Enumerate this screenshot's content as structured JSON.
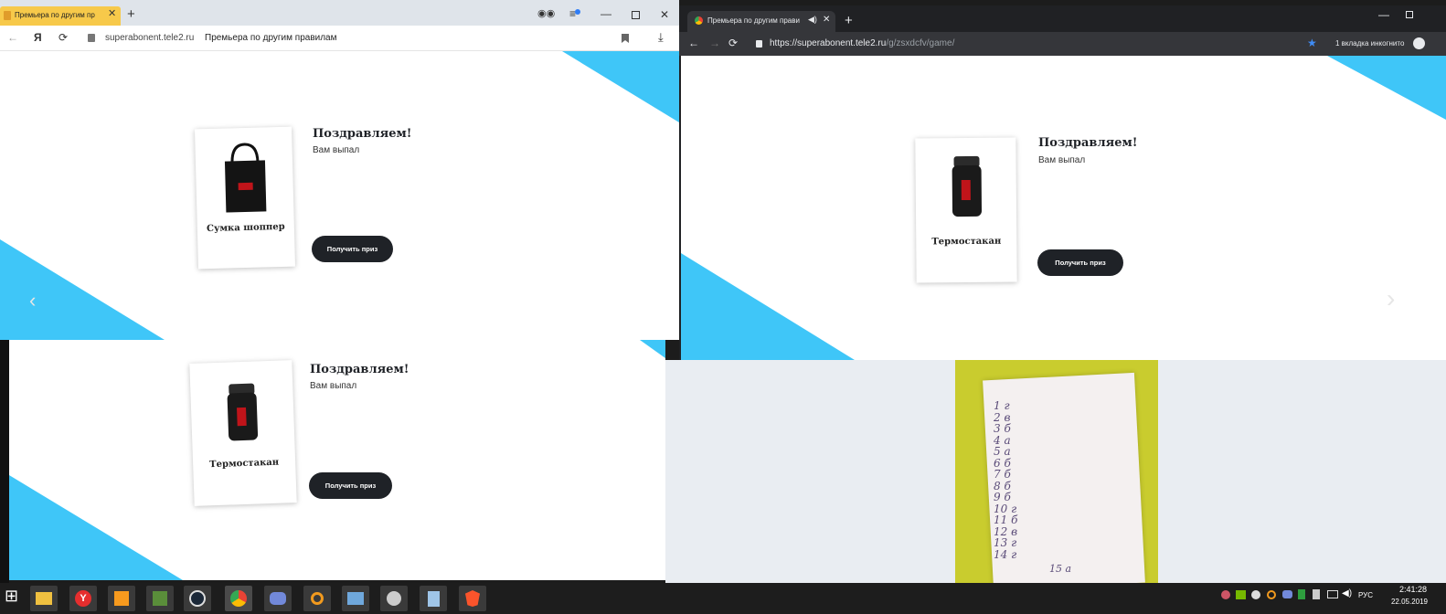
{
  "yandex_window": {
    "tab_title": "Премьера по другим пр",
    "domain": "superabonent.tele2.ru",
    "page_title": "Премьера по другим правилам",
    "yandex_logo": "Я",
    "congrats": "Поздравляем!",
    "subtitle": "Вам выпал",
    "product_name": "Сумка шоппер",
    "button_label": "Получить приз"
  },
  "chrome_window": {
    "tab_title": "Премьера по другим прави",
    "url_main": "https://superabonent.tele2.ru",
    "url_path": "/g/zsxdcfv/game/",
    "incognito_label": "1 вкладка инкогнито",
    "congrats": "Поздравляем!",
    "subtitle": "Вам выпал",
    "product_name": "Термостакан",
    "button_label": "Получить приз"
  },
  "lower_window": {
    "congrats": "Поздравляем!",
    "subtitle": "Вам выпал",
    "product_name": "Термостакан",
    "button_label": "Получить приз"
  },
  "note_lines": [
    "1 г",
    "2 в",
    "3 б",
    "4 а",
    "5 а",
    "6 б",
    "7 б",
    "8 б",
    "9 б",
    "10 г",
    "11 б",
    "12 в",
    "13 г",
    "14 г"
  ],
  "note_extra": "15 а",
  "taskbar": {
    "lang": "РУС",
    "time": "2:41:28",
    "date": "22.05.2019"
  },
  "colors": {
    "accent_blue": "#3fc6f8",
    "button_dark": "#1f2227",
    "yandex_tab": "#f7c94a"
  }
}
